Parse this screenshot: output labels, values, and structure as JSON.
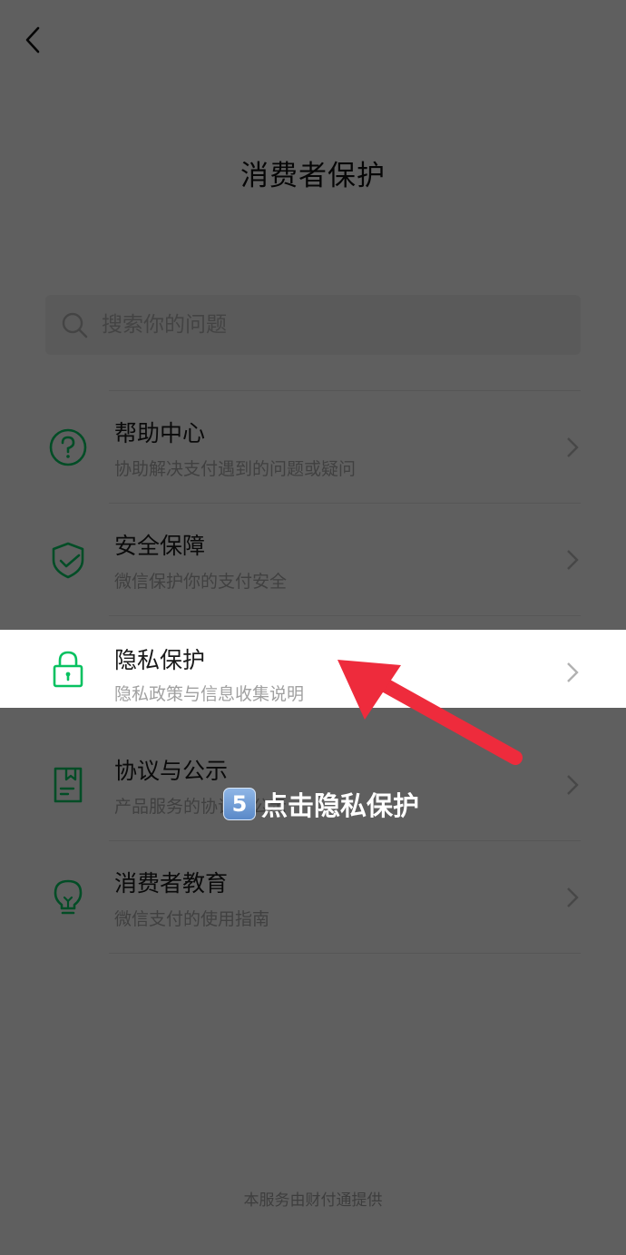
{
  "header": {
    "title": "消费者保护"
  },
  "search": {
    "placeholder": "搜索你的问题"
  },
  "items": [
    {
      "title": "帮助中心",
      "desc": "协助解决支付遇到的问题或疑问",
      "icon": "question-circle-icon"
    },
    {
      "title": "安全保障",
      "desc": "微信保护你的支付安全",
      "icon": "shield-check-icon"
    },
    {
      "title": "隐私保护",
      "desc": "隐私政策与信息收集说明",
      "icon": "lock-icon"
    },
    {
      "title": "协议与公示",
      "desc": "产品服务的协议与公示",
      "icon": "document-icon"
    },
    {
      "title": "消费者教育",
      "desc": "微信支付的使用指南",
      "icon": "lightbulb-icon"
    }
  ],
  "footer": {
    "text": "本服务由财付通提供"
  },
  "annotation": {
    "step_number": "5",
    "caption": "点击隐私保护"
  },
  "colors": {
    "accent_green": "#07c160",
    "arrow_red": "#ee2b3c"
  }
}
